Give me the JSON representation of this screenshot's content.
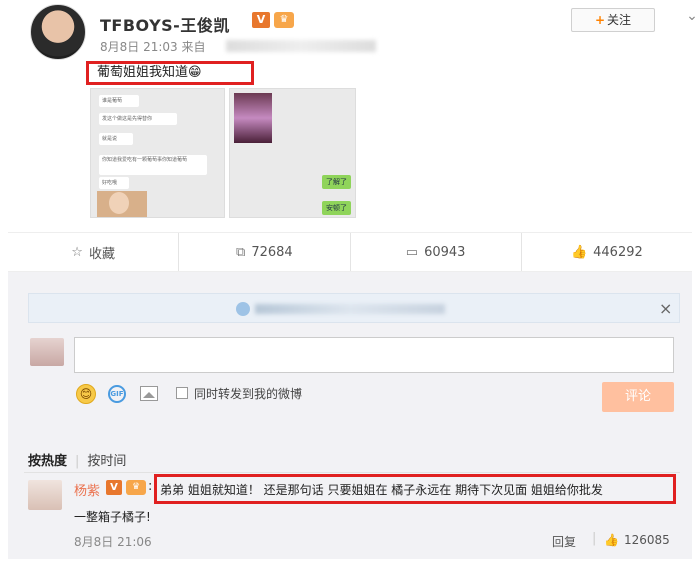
{
  "post": {
    "user_name": "TFBOYS-王俊凯",
    "v_badge": "V",
    "level_badge": "♛",
    "meta": "8月8日 21:03 来自",
    "follow_label": "关注",
    "follow_plus": "+",
    "more_icon": "chevron-down-icon",
    "text": "葡萄姐姐我知道😁"
  },
  "images": {
    "chat1_bubbles": [
      "谁是葡萄",
      "发这个做这是先得替你",
      "就是说",
      "你知道我爱吃有一颗葡萄事你知道葡萄",
      "好吃哦"
    ],
    "chat2_bubbles": [
      "了解了",
      "安顿了"
    ]
  },
  "actions": {
    "favorite": {
      "icon": "star-icon",
      "label": "收藏"
    },
    "repost": {
      "icon": "repost-icon",
      "count": "72684"
    },
    "comment": {
      "icon": "comment-icon",
      "count": "60943"
    },
    "like": {
      "icon": "thumbs-up-icon",
      "count": "446292"
    }
  },
  "comment_box": {
    "notice_close": "×",
    "emoji_icon": "😊",
    "gif_label": "GIF",
    "repost_checkbox_label": "同时转发到我的微博",
    "submit_label": "评论"
  },
  "sort": {
    "hot": "按热度",
    "separator": "|",
    "time": "按时间"
  },
  "comments": [
    {
      "user": "杨紫",
      "v_badge": "V",
      "level_badge": "♛",
      "colon": ":",
      "text_line1": "弟弟 姐姐就知道！ 还是那句话 只要姐姐在 橘子永远在 期待下次见面 姐姐给你批发",
      "text_line2": "一整箱子橘子!",
      "time": "8月8日 21:06",
      "reply_label": "回复",
      "separator": "|",
      "like_count": "126085"
    }
  ],
  "colors": {
    "accent": "#ff8200",
    "highlight_box": "#e02020",
    "comment_username": "#eb7350",
    "submit_button": "#ffc09f"
  }
}
